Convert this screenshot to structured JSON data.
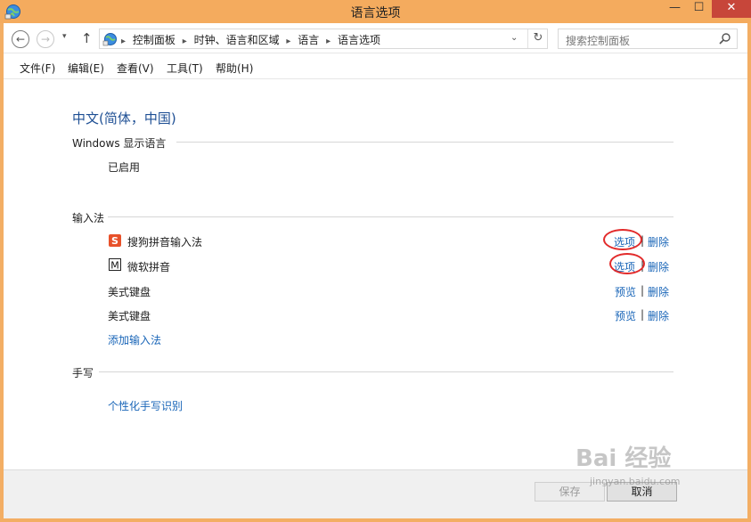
{
  "window": {
    "title": "语言选项",
    "min_glyph": "—",
    "max_glyph": "☐",
    "close_glyph": "✕",
    "icon": "control-panel-globe-icon"
  },
  "nav": {
    "back_glyph": "←",
    "forward_glyph": "→",
    "history_glyph": "▾",
    "up_glyph": "↑",
    "breadcrumbs": [
      "控制面板",
      "时钟、语言和区域",
      "语言",
      "语言选项"
    ],
    "breadcrumb_sep": "▸",
    "dropdown_glyph": "⌄",
    "refresh_glyph": "↻",
    "search_placeholder": "搜索控制面板"
  },
  "menu": [
    "文件(F)",
    "编辑(E)",
    "查看(V)",
    "工具(T)",
    "帮助(H)"
  ],
  "main": {
    "language_title": "中文(简体，中国)",
    "display_section": {
      "heading": "Windows 显示语言",
      "status": "已启用"
    },
    "input_section": {
      "heading": "输入法",
      "methods": [
        {
          "name": "搜狗拼音输入法",
          "icon": "sogou-s-icon",
          "action": "选项",
          "remove": "删除",
          "highlighted": true
        },
        {
          "name": "微软拼音",
          "icon": "microsoft-m-icon",
          "action": "选项",
          "remove": "删除",
          "highlighted": true
        },
        {
          "name": "美式键盘",
          "icon": "",
          "action": "预览",
          "remove": "删除",
          "highlighted": false
        },
        {
          "name": "美式键盘",
          "icon": "",
          "action": "预览",
          "remove": "删除",
          "highlighted": false
        }
      ],
      "separator": "|",
      "add_link": "添加输入法"
    },
    "handwriting_section": {
      "heading": "手写",
      "link": "个性化手写识别"
    }
  },
  "footer": {
    "save_label": "保存",
    "cancel_label": "取消"
  },
  "watermark": {
    "main": "Bai  经验",
    "sub": "jingyan.baidu.com"
  },
  "colors": {
    "title_bar": "#f4ab5e",
    "link": "#1a66b8",
    "heading": "#1e4f94",
    "annotation_circle": "#e22a2a",
    "close_button": "#c7463a"
  }
}
